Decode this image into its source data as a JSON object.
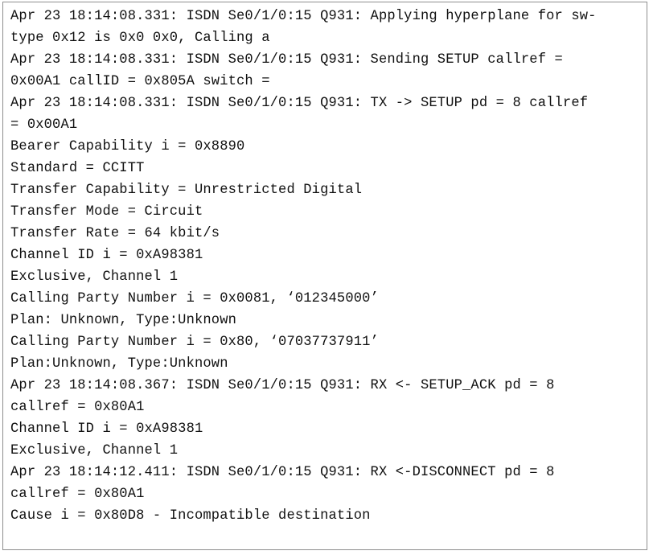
{
  "document": {
    "kind": "router-debug-log",
    "title": "ISDN Q931 debug output",
    "border_color": "#8e8e8e",
    "background_color": "#ffffff",
    "text_color": "#111111"
  },
  "log": {
    "lines": [
      "Apr 23 18:14:08.331: ISDN Se0/1/0:15 Q931: Applying hyperplane for sw-",
      "type 0x12 is 0x0 0x0, Calling a",
      "Apr 23 18:14:08.331: ISDN Se0/1/0:15 Q931: Sending SETUP callref =",
      "0x00A1 callID = 0x805A switch =",
      "Apr 23 18:14:08.331: ISDN Se0/1/0:15 Q931: TX -> SETUP pd = 8 callref",
      "= 0x00A1",
      "Bearer Capability i = 0x8890",
      "Standard = CCITT",
      "Transfer Capability = Unrestricted Digital",
      "Transfer Mode = Circuit",
      "Transfer Rate = 64 kbit/s",
      "Channel ID i = 0xA98381",
      "Exclusive, Channel 1",
      "Calling Party Number i = 0x0081, ‘012345000’",
      "Plan: Unknown, Type:Unknown",
      "Calling Party Number i = 0x80, ‘07037737911’",
      "Plan:Unknown, Type:Unknown",
      "Apr 23 18:14:08.367: ISDN Se0/1/0:15 Q931: RX <- SETUP_ACK pd = 8",
      "callref = 0x80A1",
      "Channel ID i = 0xA98381",
      "Exclusive, Channel 1",
      "Apr 23 18:14:12.411: ISDN Se0/1/0:15 Q931: RX <-DISCONNECT pd = 8",
      "callref = 0x80A1",
      "Cause i = 0x80D8 - Incompatible destination"
    ],
    "wrapped_flags": [
      false,
      true,
      false,
      true,
      false,
      true,
      false,
      false,
      false,
      false,
      false,
      false,
      false,
      false,
      false,
      false,
      false,
      false,
      true,
      false,
      false,
      false,
      true,
      false
    ]
  }
}
